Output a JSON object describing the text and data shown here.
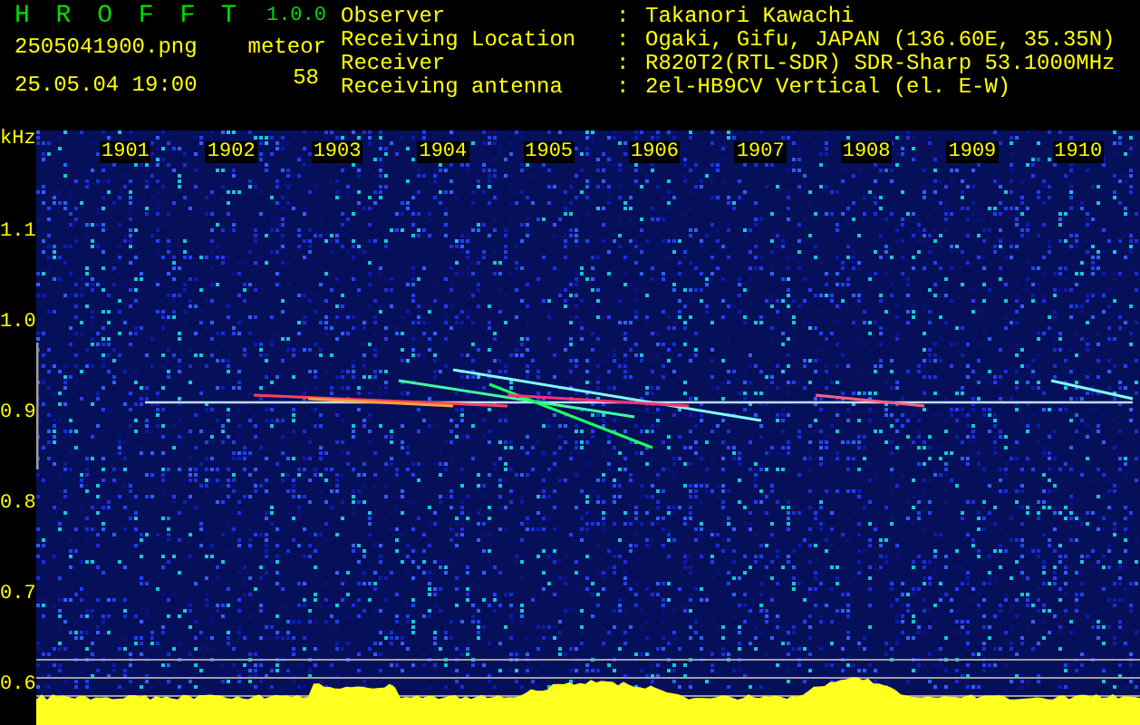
{
  "app": {
    "title": "H R O F F T",
    "version": "1.0.0",
    "filename": "2505041900.png",
    "datetime": "25.05.04 19:00"
  },
  "meteor": {
    "label": "meteor",
    "count": "58"
  },
  "info": [
    {
      "label": "Observer",
      "separator": ":",
      "value": "Takanori Kawachi"
    },
    {
      "label": "Receiving Location",
      "separator": ":",
      "value": "Ogaki, Gifu, JAPAN (136.60E, 35.35N)"
    },
    {
      "label": "Receiver",
      "separator": ":",
      "value": "R820T2(RTL-SDR) SDR-Sharp 53.1000MHz"
    },
    {
      "label": "Receiving antenna",
      "separator": ":",
      "value": "2el-HB9CV Vertical (el. E-W)"
    }
  ],
  "spectrogram": {
    "y_unit": "kHz",
    "x_labels": [
      "1901",
      "1902",
      "1903",
      "1904",
      "1905",
      "1906",
      "1907",
      "1908",
      "1909",
      "1910"
    ],
    "y_labels": [
      "1.1",
      "1.0",
      "0.9",
      "0.8",
      "0.7",
      "0.6"
    ]
  }
}
